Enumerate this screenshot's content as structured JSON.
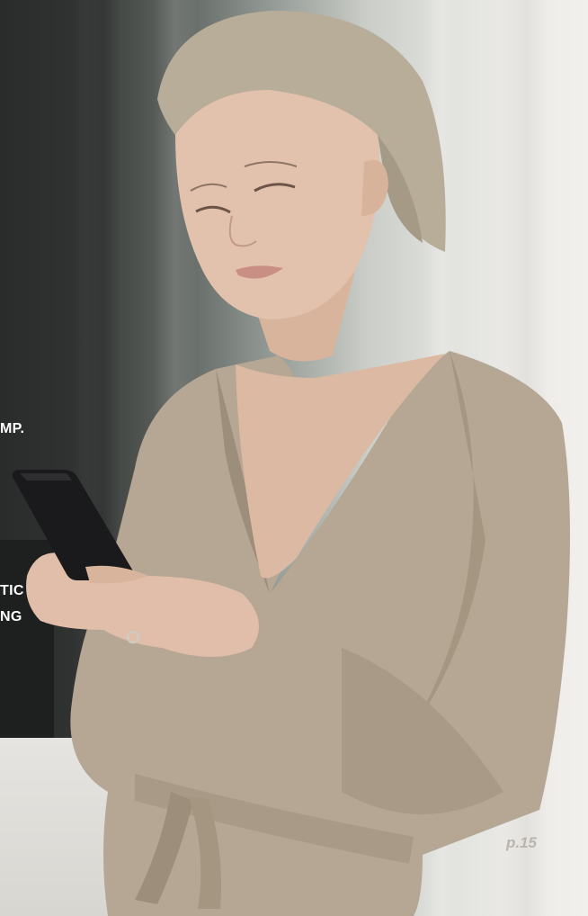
{
  "side_text": {
    "line_1": "MP.",
    "line_2": "TIC",
    "line_3": "NG"
  },
  "page_number": "p.15",
  "colors": {
    "background_dark": "#2f3231",
    "background_light": "#f2f0ec",
    "robe": "#b5a793",
    "robe_shadow": "#9c8e7b",
    "skin": "#e2c2ad",
    "hair": "#b8ad98",
    "phone": "#1a1a1c",
    "text": "#ffffff",
    "page_number": "#b9b4ad"
  }
}
